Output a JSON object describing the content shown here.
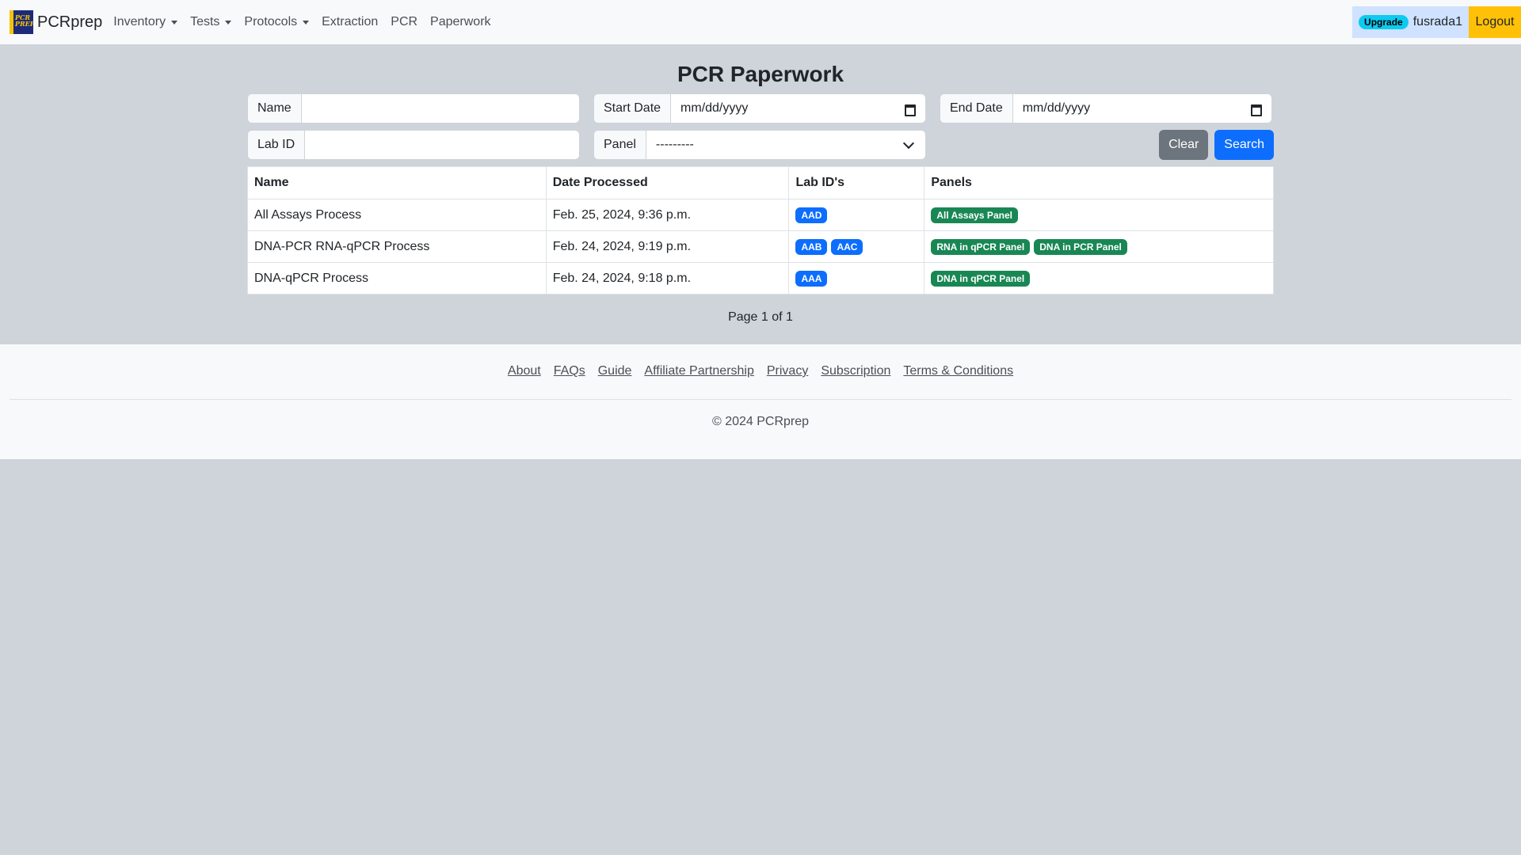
{
  "nav": {
    "brand": "PCRprep",
    "logo_text": "PCR PREP",
    "links": [
      {
        "label": "Inventory",
        "dropdown": true
      },
      {
        "label": "Tests",
        "dropdown": true
      },
      {
        "label": "Protocols",
        "dropdown": true
      },
      {
        "label": "Extraction",
        "dropdown": false
      },
      {
        "label": "PCR",
        "dropdown": false
      },
      {
        "label": "Paperwork",
        "dropdown": false
      }
    ],
    "upgrade_label": "Upgrade",
    "username": "fusrada1",
    "logout_label": "Logout"
  },
  "page": {
    "title": "PCR Paperwork"
  },
  "filters": {
    "name_label": "Name",
    "name_value": "",
    "start_date_label": "Start Date",
    "start_date_placeholder": "mm/dd/yyyy",
    "end_date_label": "End Date",
    "end_date_placeholder": "mm/dd/yyyy",
    "lab_id_label": "Lab ID",
    "lab_id_value": "",
    "panel_label": "Panel",
    "panel_selected": "---------",
    "clear_label": "Clear",
    "search_label": "Search"
  },
  "table": {
    "headers": [
      "Name",
      "Date Processed",
      "Lab ID's",
      "Panels"
    ],
    "rows": [
      {
        "name": "All Assays Process",
        "date": "Feb. 25, 2024, 9:36 p.m.",
        "lab_ids": [
          "AAD"
        ],
        "panels": [
          "All Assays Panel"
        ]
      },
      {
        "name": "DNA-PCR RNA-qPCR Process",
        "date": "Feb. 24, 2024, 9:19 p.m.",
        "lab_ids": [
          "AAB",
          "AAC"
        ],
        "panels": [
          "RNA in qPCR Panel",
          "DNA in PCR Panel"
        ]
      },
      {
        "name": "DNA-qPCR Process",
        "date": "Feb. 24, 2024, 9:18 p.m.",
        "lab_ids": [
          "AAA"
        ],
        "panels": [
          "DNA in qPCR Panel"
        ]
      }
    ]
  },
  "pagination": {
    "text": "Page 1 of 1"
  },
  "footer": {
    "links": [
      "About",
      "FAQs",
      "Guide",
      "Affiliate Partnership",
      "Privacy",
      "Subscription",
      "Terms & Conditions"
    ],
    "copyright": "© 2024 PCRprep"
  },
  "colors": {
    "primary": "#0d6efd",
    "success": "#198754",
    "secondary": "#6c757d",
    "warning": "#ffc107",
    "info": "#0dcaf0",
    "background": "#cfd4db"
  }
}
